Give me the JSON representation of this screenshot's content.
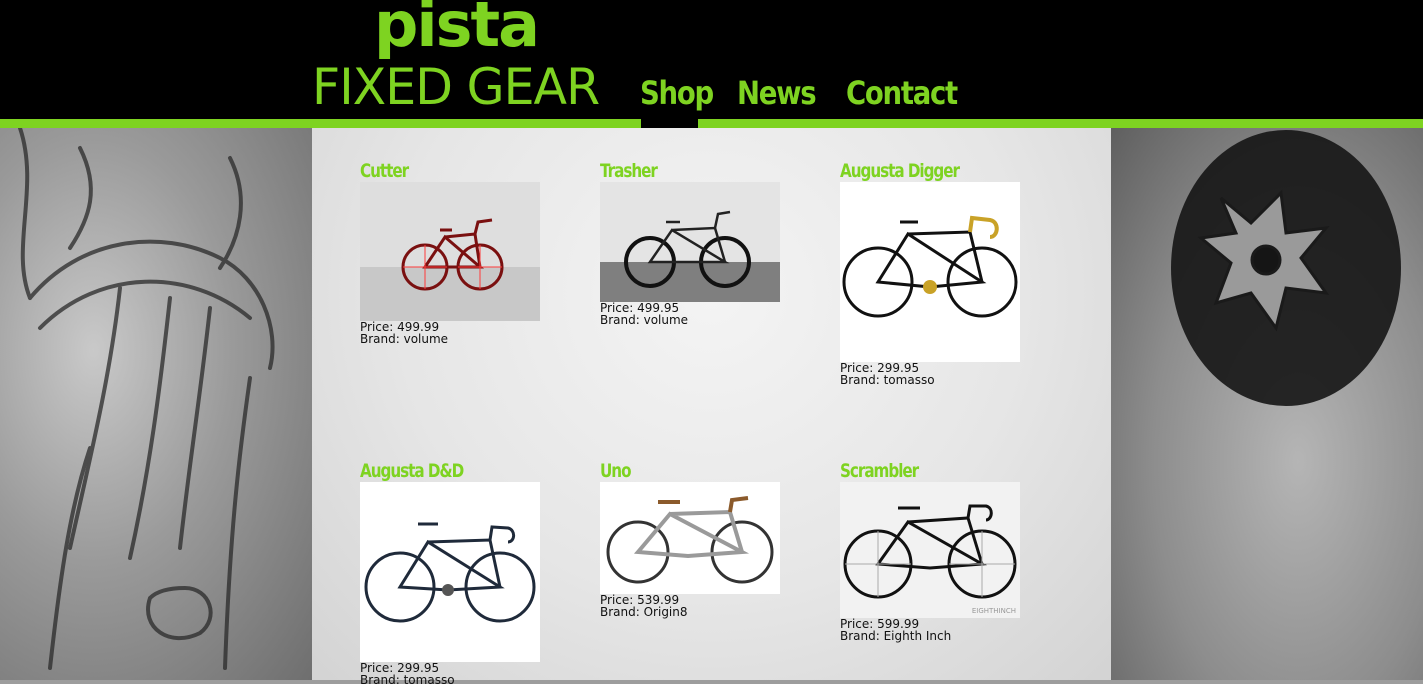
{
  "logo": {
    "line1": "pista",
    "line2": "FIXED GEAR"
  },
  "nav": [
    {
      "label": "Shop",
      "active": true
    },
    {
      "label": "News",
      "active": false
    },
    {
      "label": "Contact",
      "active": false
    }
  ],
  "colors": {
    "accent": "#7ed321",
    "header_bg": "#000000",
    "text": "#111111"
  },
  "products": [
    {
      "name": "Cutter",
      "price_text": "Price: 499.99",
      "brand_text": "Brand: volume",
      "image": "red fixed gear bike"
    },
    {
      "name": "Trasher",
      "price_text": "Price: 499.95",
      "brand_text": "Brand: volume",
      "image": "black fixed gear bike"
    },
    {
      "name": "Augusta Digger",
      "price_text": "Price: 299.95",
      "brand_text": "Brand: tomasso",
      "image": "black bike with gold bars"
    },
    {
      "name": "Augusta D&D",
      "price_text": "Price: 299.95",
      "brand_text": "Brand: tomasso",
      "image": "navy track bike"
    },
    {
      "name": "Uno",
      "price_text": "Price: 539.99",
      "brand_text": "Brand: Origin8",
      "image": "silver single speed bike"
    },
    {
      "name": "Scrambler",
      "price_text": "Price: 599.99",
      "brand_text": "Brand: Eighth Inch",
      "image": "black track bike"
    }
  ],
  "image_watermark": "EIGHTHINCH"
}
